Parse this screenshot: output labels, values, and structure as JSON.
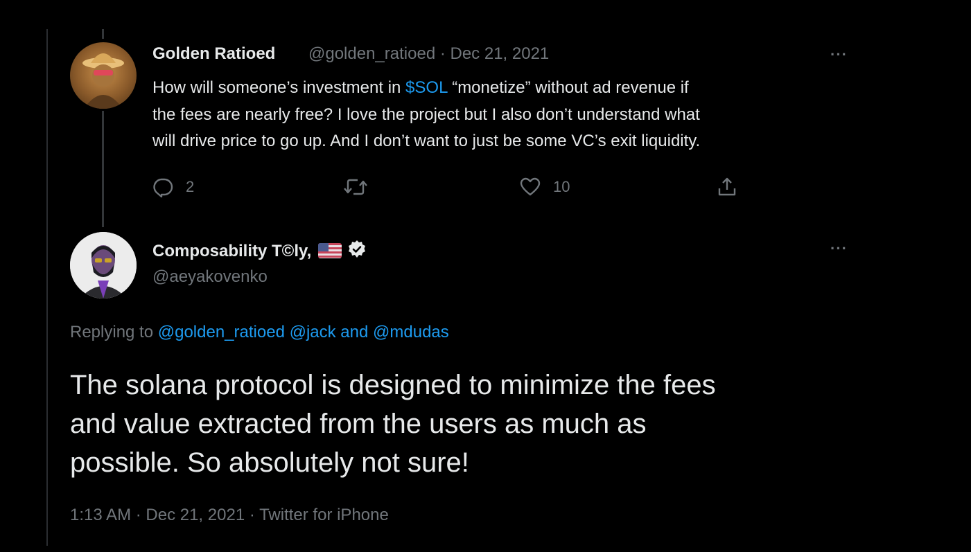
{
  "parent_tweet": {
    "name": "Golden Ratioed",
    "handle": "@golden_ratioed",
    "separator": " · ",
    "date": "Dec 21, 2021",
    "more": "···",
    "text_before": "How will someone’s investment in ",
    "cashtag": "$SOL",
    "text_line1_after": " “monetize” without ad revenue if",
    "text_line2": "the fees are nearly free? I love the project but I also don’t understand what",
    "text_line3": "will drive price to go up. And I don’t want to just be some VC’s exit liquidity.",
    "actions": {
      "reply_count": "2",
      "retweet_count": "",
      "like_count": "10"
    }
  },
  "reply_tweet": {
    "name": "Composability T©ly,",
    "handle": "@aeyakovenko",
    "more": "···",
    "replying_prefix": "Replying to ",
    "replying_to_1": "@golden_ratioed",
    "replying_to_2": "@jack",
    "replying_and": " and ",
    "replying_to_3": "@mdudas",
    "line1": "The solana protocol is designed to minimize the fees",
    "line2": "and value extracted from the users as much as",
    "line3": "possible. So absolutely not sure!",
    "time": "1:13 AM",
    "date": "Dec 21, 2021",
    "source": "Twitter for iPhone",
    "meta_sep": " · "
  },
  "colors": {
    "background": "#000000",
    "text": "#e7e9ea",
    "muted": "#71767b",
    "link": "#1d9bf0"
  }
}
